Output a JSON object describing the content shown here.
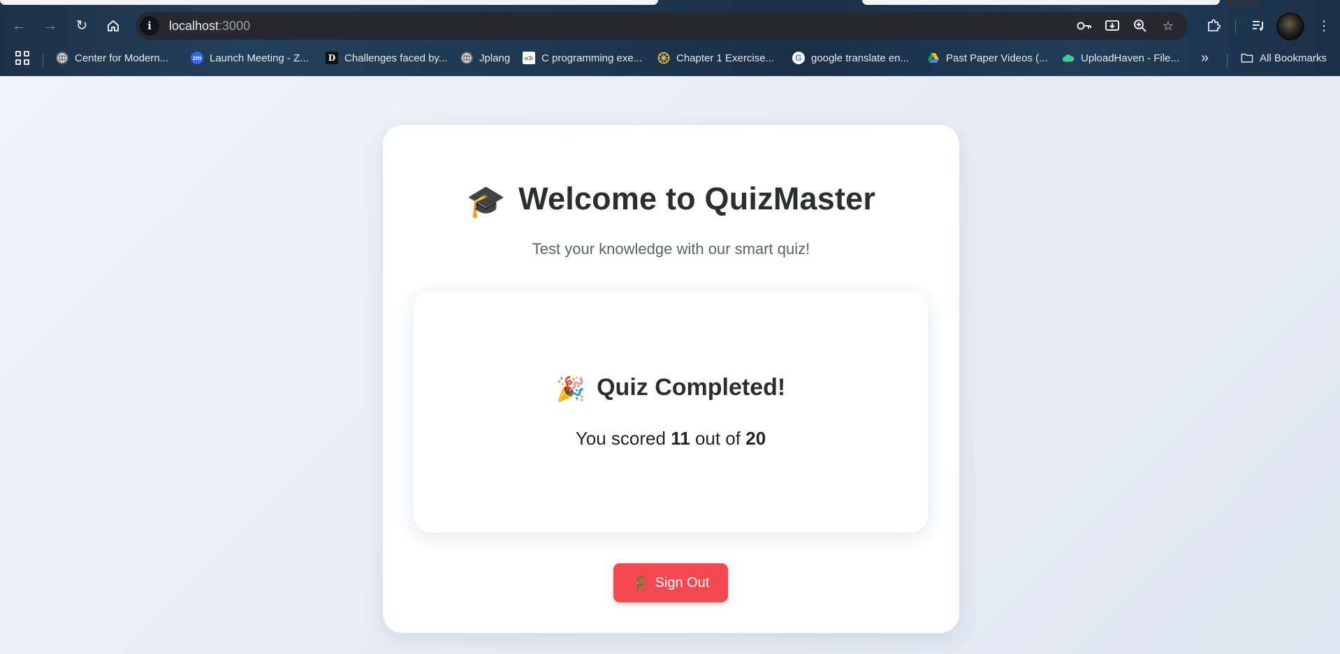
{
  "browser": {
    "url_host": "localhost",
    "url_port": ":3000",
    "bookmarks": [
      {
        "label": "Center for Modern...",
        "icon": "globe-icon"
      },
      {
        "label": "Launch Meeting - Z...",
        "icon": "zoom-icon",
        "icon_text": "zm"
      },
      {
        "label": "Challenges faced by...",
        "icon": "d-logo-icon",
        "icon_text": "D"
      },
      {
        "label": "Jplang",
        "icon": "globe-icon"
      },
      {
        "label": "C programming exe...",
        "icon": "w3r-icon",
        "icon_text": "w3r"
      },
      {
        "label": "Chapter 1 Exercise...",
        "icon": "wheel-icon"
      },
      {
        "label": "google translate en...",
        "icon": "google-icon",
        "icon_text": "G"
      },
      {
        "label": "Past Paper Videos (...",
        "icon": "drive-icon"
      },
      {
        "label": "UploadHaven - File...",
        "icon": "cloud-icon"
      }
    ],
    "all_bookmarks": "All Bookmarks",
    "overflow": "»"
  },
  "app": {
    "title_emoji": "🎓",
    "title": "Welcome to QuizMaster",
    "subtitle": "Test your knowledge with our smart quiz!",
    "result": {
      "emoji": "🎉",
      "heading": "Quiz Completed!",
      "score_prefix": "You scored",
      "score": "11",
      "score_mid": "out of",
      "total": "20"
    },
    "signout": {
      "emoji": "🚪",
      "label": "Sign Out"
    }
  },
  "colors": {
    "signout_bg": "#f5494f",
    "page_bg": "#e9eef6",
    "card_bg": "#ffffff"
  }
}
